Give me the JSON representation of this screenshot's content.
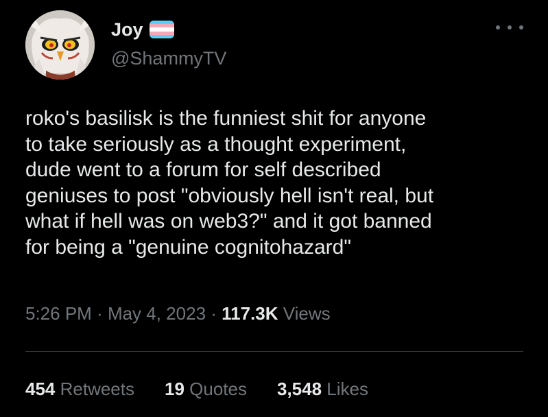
{
  "colors": {
    "background": "#000000",
    "text_primary": "#e7e9ea",
    "text_secondary": "#71767b",
    "divider": "#2f3336",
    "flag_stripes": [
      "#5bcefa",
      "#f5a9b8",
      "#ffffff",
      "#f5a9b8",
      "#5bcefa"
    ]
  },
  "author": {
    "display_name": "Joy",
    "handle": "@ShammyTV",
    "flag_icon": "transgender-flag-emoji",
    "avatar_icon": "cartoon-owl-avatar"
  },
  "more_icon": "ellipsis-horizontal-icon",
  "tweet": {
    "lines": [
      "roko's basilisk is the funniest shit for anyone",
      "to take seriously as a thought experiment,",
      "dude went to a forum for self described",
      "geniuses to post \"obviously hell isn't real, but",
      "what if hell was on web3?\" and it got banned",
      "for being a \"genuine cognitohazard\""
    ]
  },
  "meta": {
    "time": "5:26 PM",
    "separator": " · ",
    "date": "May 4, 2023",
    "views_count": "117.3K",
    "views_label": " Views"
  },
  "stats": {
    "retweets_count": "454",
    "retweets_label": " Retweets",
    "quotes_count": "19",
    "quotes_label": " Quotes",
    "likes_count": "3,548",
    "likes_label": " Likes"
  }
}
